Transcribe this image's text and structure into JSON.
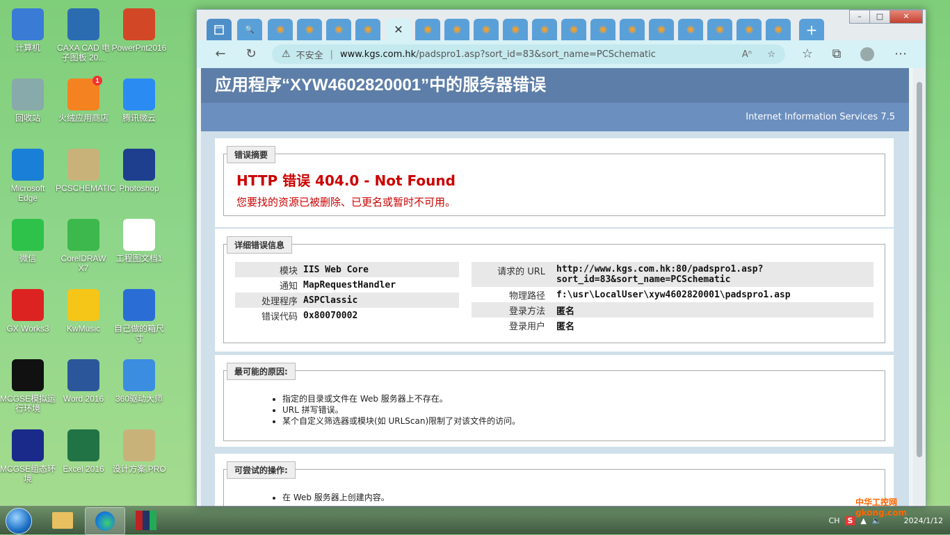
{
  "desktop": {
    "icons": [
      {
        "label": "计算机"
      },
      {
        "label": "CAXA CAD 电子图板 20..."
      },
      {
        "label": "PowerPnt2016"
      },
      {
        "label": "回收站"
      },
      {
        "label": "火绒应用商店",
        "badge": "1"
      },
      {
        "label": "腾讯微云"
      },
      {
        "label": "Microsoft Edge"
      },
      {
        "label": "PCSCHEMATIC"
      },
      {
        "label": "Photoshop"
      },
      {
        "label": "微信"
      },
      {
        "label": "CorelDRAW X7"
      },
      {
        "label": "工程图文档1"
      },
      {
        "label": "GX Works3"
      },
      {
        "label": "KwMusic"
      },
      {
        "label": "自己做的箱尺寸"
      },
      {
        "label": "MCGSE模拟运行环境"
      },
      {
        "label": "Word 2016"
      },
      {
        "label": "360驱动大师"
      },
      {
        "label": "MCGSE组态环境"
      },
      {
        "label": "Excel 2016"
      },
      {
        "label": "设计方案.PRO"
      }
    ]
  },
  "browser": {
    "url_security": "不安全",
    "url_host": "www.kgs.com.hk",
    "url_path": "/padspro1.asp?sort_id=83&sort_name=PCSchematic"
  },
  "iis": {
    "title": "应用程序“XYW4602820001”中的服务器错误",
    "server": "Internet Information Services 7.5",
    "summary_legend": "错误摘要",
    "error_title": "HTTP 错误 404.0 - Not Found",
    "error_desc": "您要找的资源已被删除、已更名或暂时不可用。",
    "detail_legend": "详细错误信息",
    "left_rows": [
      {
        "k": "模块",
        "v": "IIS Web Core"
      },
      {
        "k": "通知",
        "v": "MapRequestHandler"
      },
      {
        "k": "处理程序",
        "v": "ASPClassic"
      },
      {
        "k": "错误代码",
        "v": "0x80070002"
      }
    ],
    "url_label": "请求的 URL",
    "url_value_1": "http://www.kgs.com.hk:80/padspro1.asp?",
    "url_value_2": "sort_id=83&sort_name=PCSchematic",
    "right_rows": [
      {
        "k": "物理路径",
        "v": "f:\\usr\\LocalUser\\xyw4602820001\\padspro1.asp"
      },
      {
        "k": "登录方法",
        "v": "匿名"
      },
      {
        "k": "登录用户",
        "v": "匿名"
      }
    ],
    "causes_legend": "最可能的原因:",
    "causes": [
      "指定的目录或文件在 Web 服务器上不存在。",
      "URL 拼写错误。",
      "某个自定义筛选器或模块(如 URLScan)限制了对该文件的访问。"
    ],
    "actions_legend": "可尝试的操作:",
    "actions": [
      "在 Web 服务器上创建内容。"
    ]
  },
  "tray": {
    "lang": "CH",
    "date": "2024/1/12"
  },
  "watermark": "中华工控网 gkong.com"
}
